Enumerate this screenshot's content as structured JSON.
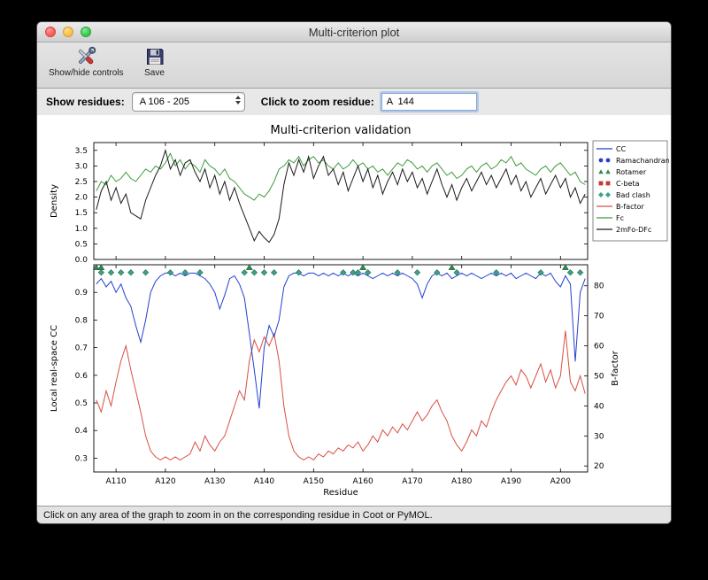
{
  "window": {
    "title": "Multi-criterion plot",
    "toolbar": [
      {
        "label": "Show/hide controls",
        "icon": "tools-icon"
      },
      {
        "label": "Save",
        "icon": "save-icon"
      }
    ],
    "controls": {
      "show_residues_label": "Show residues:",
      "residue_range_value": "A 106 - 205",
      "zoom_label": "Click to zoom residue:",
      "zoom_value": "A  144"
    },
    "status_bar": "Click on any area of the graph to zoom in on the corresponding residue in Coot or PyMOL."
  },
  "legend": {
    "entries": [
      {
        "label": "CC",
        "type": "line",
        "color": "#2440cf"
      },
      {
        "label": "Ramachandran",
        "type": "circles",
        "color": "#2440cf"
      },
      {
        "label": "Rotamer",
        "type": "triangles",
        "color": "#2c8c50"
      },
      {
        "label": "C-beta",
        "type": "squares",
        "color": "#c23b2e"
      },
      {
        "label": "Bad clash",
        "type": "diamonds",
        "color": "#3aa487"
      },
      {
        "label": "B-factor",
        "type": "line",
        "color": "#d94f44"
      },
      {
        "label": "Fc",
        "type": "line",
        "color": "#3d9b3d"
      },
      {
        "label": "2mFo-DFc",
        "type": "line",
        "color": "#1a1a1a"
      }
    ]
  },
  "chart_data": [
    {
      "type": "line",
      "title": "Multi-criterion validation",
      "ylabel": "Density",
      "xlim": [
        105.5,
        205.5
      ],
      "ylim": [
        0,
        3.75
      ],
      "yticks": [
        0.0,
        0.5,
        1.0,
        1.5,
        2.0,
        2.5,
        3.0,
        3.5
      ],
      "x_start": 106,
      "series": [
        {
          "name": "Fc",
          "color": "#3d9b3d",
          "values": [
            2.2,
            2.5,
            2.4,
            2.7,
            2.5,
            2.6,
            2.8,
            2.6,
            2.5,
            2.7,
            2.9,
            2.8,
            3.0,
            2.9,
            3.1,
            3.4,
            3.0,
            3.2,
            2.9,
            3.1,
            3.0,
            2.8,
            3.2,
            3.0,
            2.9,
            2.7,
            2.9,
            2.6,
            2.5,
            2.3,
            2.1,
            2.0,
            1.9,
            2.1,
            2.0,
            2.2,
            2.5,
            2.9,
            3.0,
            3.2,
            3.1,
            3.3,
            3.0,
            3.2,
            3.3,
            3.1,
            3.2,
            3.0,
            2.9,
            3.1,
            2.9,
            3.0,
            3.2,
            3.0,
            3.1,
            2.9,
            3.0,
            2.8,
            2.9,
            2.7,
            2.9,
            3.1,
            3.0,
            3.2,
            3.1,
            2.9,
            3.0,
            2.8,
            3.0,
            3.1,
            2.9,
            2.7,
            2.8,
            2.6,
            2.7,
            2.9,
            3.0,
            2.8,
            3.0,
            3.1,
            2.9,
            3.0,
            3.2,
            3.1,
            3.3,
            3.0,
            3.1,
            2.9,
            2.8,
            2.7,
            2.9,
            3.0,
            2.8,
            3.0,
            3.1,
            2.9,
            2.7,
            2.8,
            2.5,
            2.4
          ]
        },
        {
          "name": "2mFo-DFc",
          "color": "#1a1a1a",
          "values": [
            1.6,
            2.2,
            2.5,
            1.9,
            2.3,
            1.8,
            2.1,
            1.5,
            1.4,
            1.3,
            1.9,
            2.3,
            2.7,
            3.0,
            3.5,
            2.9,
            3.2,
            2.7,
            3.1,
            3.2,
            2.8,
            2.5,
            2.9,
            2.3,
            2.7,
            2.1,
            2.5,
            1.9,
            2.3,
            1.8,
            1.4,
            1.0,
            0.6,
            0.9,
            0.7,
            0.55,
            0.8,
            1.3,
            2.4,
            3.1,
            2.7,
            3.2,
            2.8,
            3.3,
            2.6,
            3.0,
            3.3,
            2.7,
            2.9,
            2.4,
            2.8,
            2.2,
            2.6,
            3.0,
            2.5,
            2.9,
            2.3,
            2.7,
            2.1,
            2.5,
            2.8,
            2.4,
            2.9,
            2.5,
            2.8,
            2.3,
            2.6,
            2.1,
            2.5,
            2.9,
            2.4,
            2.0,
            2.4,
            1.9,
            2.3,
            2.6,
            2.2,
            2.5,
            2.8,
            2.4,
            2.7,
            2.3,
            2.6,
            2.9,
            2.4,
            2.7,
            2.2,
            2.5,
            2.0,
            2.3,
            2.6,
            2.1,
            2.4,
            2.7,
            2.3,
            2.6,
            2.0,
            2.3,
            1.8,
            2.1
          ]
        }
      ]
    },
    {
      "type": "line",
      "xlabel": "Residue",
      "ylabel_left": "Local real-space CC",
      "ylabel_right": "B-factor",
      "xlim": [
        105.5,
        205.5
      ],
      "ylim_left": [
        0.25,
        1.0
      ],
      "ylim_right": [
        18,
        87
      ],
      "yticks_left": [
        0.3,
        0.4,
        0.5,
        0.6,
        0.7,
        0.8,
        0.9
      ],
      "yticks_right": [
        20,
        30,
        40,
        50,
        60,
        70,
        80
      ],
      "xticks": [
        110,
        120,
        130,
        140,
        150,
        160,
        170,
        180,
        190,
        200
      ],
      "xtick_labels": [
        "A110",
        "A120",
        "A130",
        "A140",
        "A150",
        "A160",
        "A170",
        "A180",
        "A190",
        "A200"
      ],
      "x_start": 106,
      "series": [
        {
          "name": "CC",
          "axis": "left",
          "color": "#2440cf",
          "values": [
            0.93,
            0.95,
            0.92,
            0.94,
            0.9,
            0.93,
            0.88,
            0.85,
            0.78,
            0.72,
            0.8,
            0.9,
            0.94,
            0.96,
            0.97,
            0.97,
            0.96,
            0.97,
            0.96,
            0.97,
            0.97,
            0.96,
            0.95,
            0.93,
            0.9,
            0.84,
            0.89,
            0.95,
            0.96,
            0.93,
            0.88,
            0.75,
            0.62,
            0.48,
            0.7,
            0.78,
            0.74,
            0.8,
            0.92,
            0.96,
            0.97,
            0.97,
            0.96,
            0.97,
            0.97,
            0.96,
            0.97,
            0.96,
            0.97,
            0.96,
            0.97,
            0.96,
            0.97,
            0.96,
            0.97,
            0.96,
            0.95,
            0.96,
            0.97,
            0.96,
            0.97,
            0.96,
            0.97,
            0.96,
            0.95,
            0.93,
            0.88,
            0.93,
            0.96,
            0.97,
            0.96,
            0.97,
            0.95,
            0.96,
            0.97,
            0.96,
            0.97,
            0.96,
            0.95,
            0.96,
            0.97,
            0.96,
            0.97,
            0.96,
            0.97,
            0.95,
            0.96,
            0.97,
            0.96,
            0.95,
            0.97,
            0.96,
            0.97,
            0.94,
            0.92,
            0.96,
            0.93,
            0.65,
            0.9,
            0.95
          ]
        },
        {
          "name": "B-factor",
          "axis": "right",
          "color": "#d94f44",
          "values": [
            42,
            38,
            45,
            40,
            48,
            55,
            60,
            52,
            45,
            38,
            30,
            25,
            23,
            22,
            23,
            22,
            23,
            22,
            23,
            24,
            28,
            25,
            30,
            27,
            25,
            28,
            30,
            35,
            40,
            45,
            42,
            55,
            62,
            58,
            63,
            60,
            64,
            55,
            40,
            30,
            25,
            23,
            22,
            23,
            22,
            24,
            23,
            25,
            24,
            26,
            25,
            27,
            26,
            28,
            25,
            27,
            30,
            28,
            32,
            30,
            33,
            31,
            34,
            32,
            35,
            38,
            35,
            37,
            40,
            42,
            38,
            35,
            30,
            27,
            25,
            28,
            32,
            30,
            35,
            33,
            38,
            42,
            45,
            48,
            50,
            47,
            52,
            50,
            46,
            50,
            54,
            48,
            52,
            46,
            50,
            65,
            48,
            45,
            50,
            44
          ]
        }
      ],
      "markers": [
        {
          "name": "Bad clash",
          "shape": "diamond",
          "color": "#3aa487",
          "y": 0.972,
          "x": [
            107,
            109,
            111,
            113,
            116,
            121,
            124,
            127,
            136,
            138,
            140,
            142,
            147,
            156,
            158,
            159,
            161,
            167,
            171,
            175,
            179,
            187,
            196,
            202,
            204
          ]
        },
        {
          "name": "Rotamer",
          "shape": "triangle",
          "color": "#2c8c50",
          "y": 0.998,
          "x": [
            106,
            107,
            137,
            160,
            178,
            201
          ]
        }
      ]
    }
  ]
}
